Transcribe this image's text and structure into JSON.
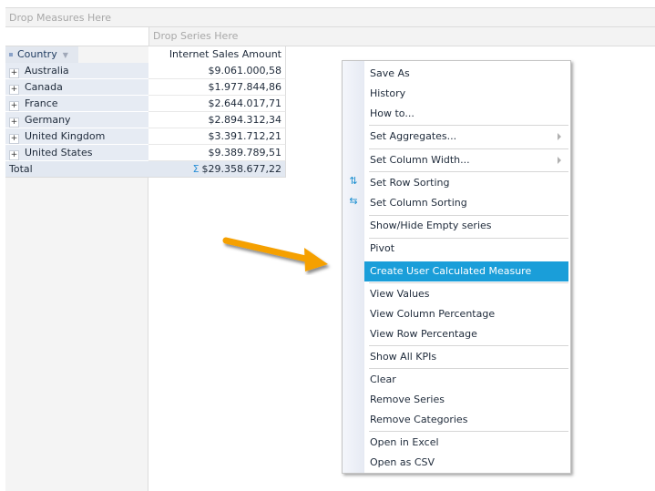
{
  "pivot": {
    "measures_drop": "Drop Measures Here",
    "series_drop": "Drop Series Here",
    "row_header": "Country",
    "measure_header": "Internet Sales Amount",
    "rows": [
      {
        "label": "Australia",
        "value": "$9.061.000,58"
      },
      {
        "label": "Canada",
        "value": "$1.977.844,86"
      },
      {
        "label": "France",
        "value": "$2.644.017,71"
      },
      {
        "label": "Germany",
        "value": "$2.894.312,34"
      },
      {
        "label": "United Kingdom",
        "value": "$3.391.712,21"
      },
      {
        "label": "United States",
        "value": "$9.389.789,51"
      }
    ],
    "total_label": "Total",
    "total_symbol": "Σ",
    "total_value": "$29.358.677,22",
    "expand_symbol": "+"
  },
  "context_menu": {
    "items": [
      {
        "label": "Save As"
      },
      {
        "label": "History"
      },
      {
        "label": "How to..."
      },
      {
        "label": "Set Aggregates..."
      },
      {
        "label": "Set Column Width..."
      },
      {
        "label": "Set Row Sorting"
      },
      {
        "label": "Set Column Sorting"
      },
      {
        "label": "Show/Hide Empty series"
      },
      {
        "label": "Pivot"
      },
      {
        "label": "Create User Calculated Measure"
      },
      {
        "label": "View Values"
      },
      {
        "label": "View Column Percentage"
      },
      {
        "label": "View Row Percentage"
      },
      {
        "label": "Show All KPIs"
      },
      {
        "label": "Clear"
      },
      {
        "label": "Remove Series"
      },
      {
        "label": "Remove Categories"
      },
      {
        "label": "Open in Excel"
      },
      {
        "label": "Open as CSV"
      }
    ],
    "highlighted": "Create User Calculated Measure",
    "icons": {
      "row_sort": "⇅",
      "col_sort": "⇆"
    }
  },
  "colors": {
    "highlight": "#1a9ed9",
    "arrow": "#f5a000",
    "sigma": "#2a8fd6"
  }
}
